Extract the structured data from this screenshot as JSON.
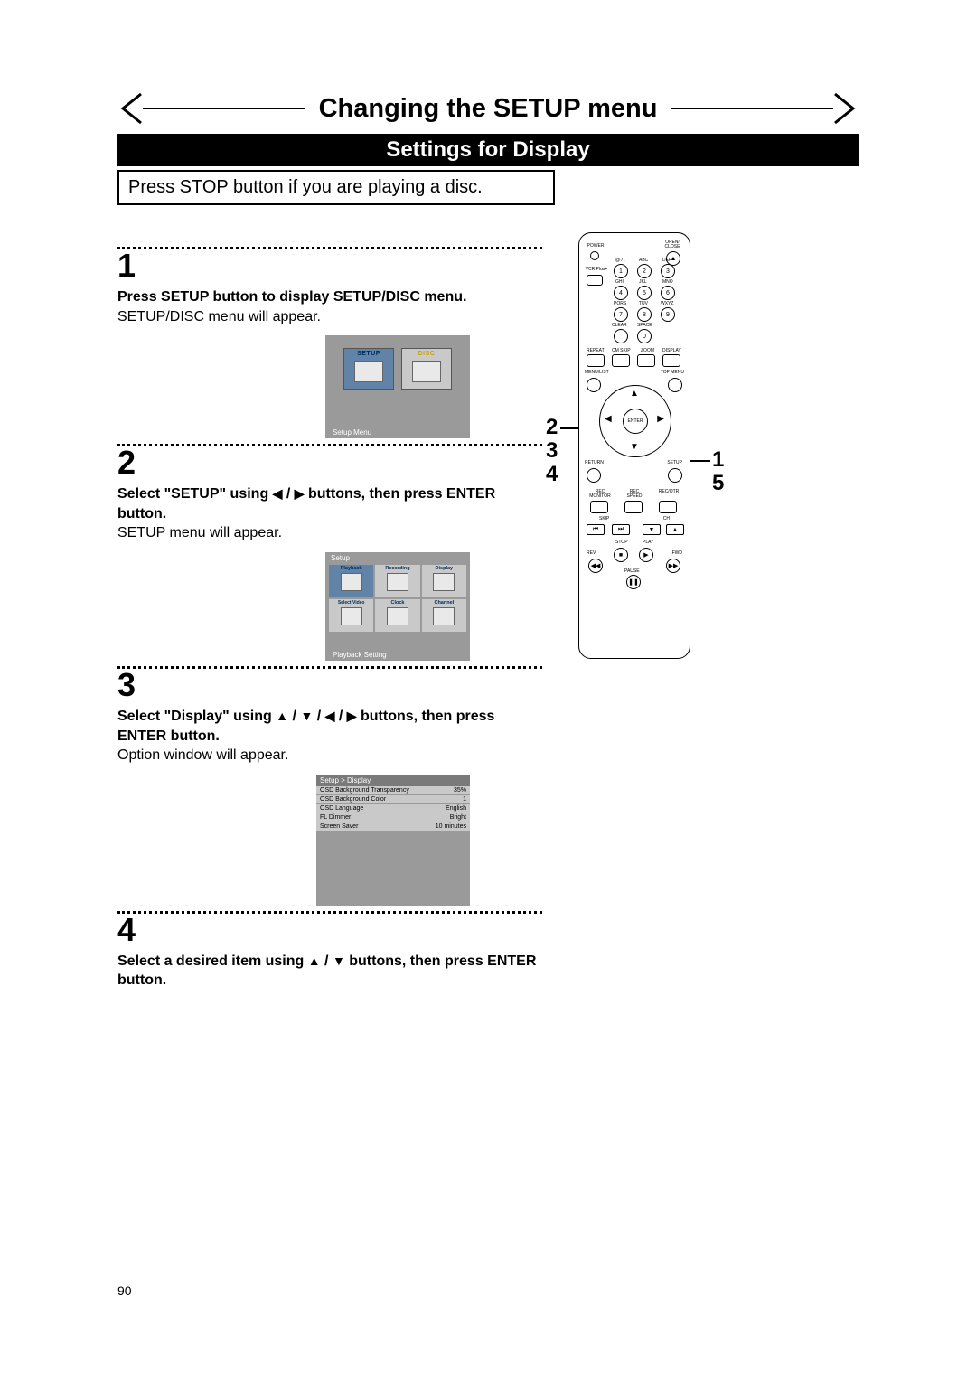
{
  "title": "Changing the SETUP menu",
  "subtitle": "Settings for Display",
  "note": "Press STOP button if you are playing a disc.",
  "steps": {
    "s1": {
      "num": "1",
      "bold": "Press SETUP button to display SETUP/DISC menu.",
      "text": "SETUP/DISC menu will appear."
    },
    "s2": {
      "num": "2",
      "bold_pre": "Select \"SETUP\" using ",
      "bold_post": " buttons, then press ENTER button.",
      "text": "SETUP menu will appear."
    },
    "s3": {
      "num": "3",
      "bold_pre": "Select \"Display\" using ",
      "bold_post": " buttons, then press ENTER button.",
      "text": "Option window will appear."
    },
    "s4": {
      "num": "4",
      "bold_pre": "Select a desired item using ",
      "bold_post": " buttons, then press ENTER button."
    }
  },
  "glyphs": {
    "left": "◀",
    "right": "▶",
    "up": "▲",
    "down": "▼",
    "slash": " / "
  },
  "osd1": {
    "tab1": "SETUP",
    "tab2": "DISC",
    "caption": "Setup Menu"
  },
  "osd2": {
    "title": "Setup",
    "cells": [
      "Playback",
      "Recording",
      "Display",
      "Select Video",
      "Clock",
      "Channel"
    ],
    "caption": "Playback Setting"
  },
  "osd3": {
    "title": "Setup > Display",
    "rows": [
      {
        "k": "OSD Background Transparency",
        "v": "35%"
      },
      {
        "k": "OSD Background Color",
        "v": "1"
      },
      {
        "k": "OSD Language",
        "v": "English"
      },
      {
        "k": "FL Dimmer",
        "v": "Bright"
      },
      {
        "k": "Screen Saver",
        "v": "10 minutes"
      }
    ]
  },
  "remote": {
    "power": "POWER",
    "open": "OPEN/ CLOSE",
    "vcr": "VCR Plus+",
    "labels_row1": [
      "@ / .",
      "ABC",
      "DEF"
    ],
    "nums_row1": [
      "1",
      "2",
      "3"
    ],
    "labels_row2": [
      "GHI",
      "JKL",
      "MNO"
    ],
    "nums_row2": [
      "4",
      "5",
      "6"
    ],
    "labels_row3": [
      "PQRS",
      "TUV",
      "WXYZ"
    ],
    "nums_row3": [
      "7",
      "8",
      "9"
    ],
    "clear": "CLEAR",
    "space": "SPACE",
    "zero": "0",
    "row_small": [
      "REPEAT",
      "CM SKIP",
      "ZOOM",
      "DISPLAY"
    ],
    "menulist": "MENU/LIST",
    "topmenu": "TOP MENU",
    "enter": "ENTER",
    "return": "RETURN",
    "setup": "SETUP",
    "rec_row": [
      "REC MONITOR",
      "REC SPEED",
      "REC/OTR"
    ],
    "skip": "SKIP",
    "ch": "CH",
    "transport": [
      "STOP",
      "PLAY"
    ],
    "rev": "REV",
    "fwd": "FWD",
    "pause": "PAUSE"
  },
  "callouts": {
    "left": [
      "2",
      "3",
      "4"
    ],
    "right": [
      "1",
      "5"
    ]
  },
  "page_number": "90"
}
